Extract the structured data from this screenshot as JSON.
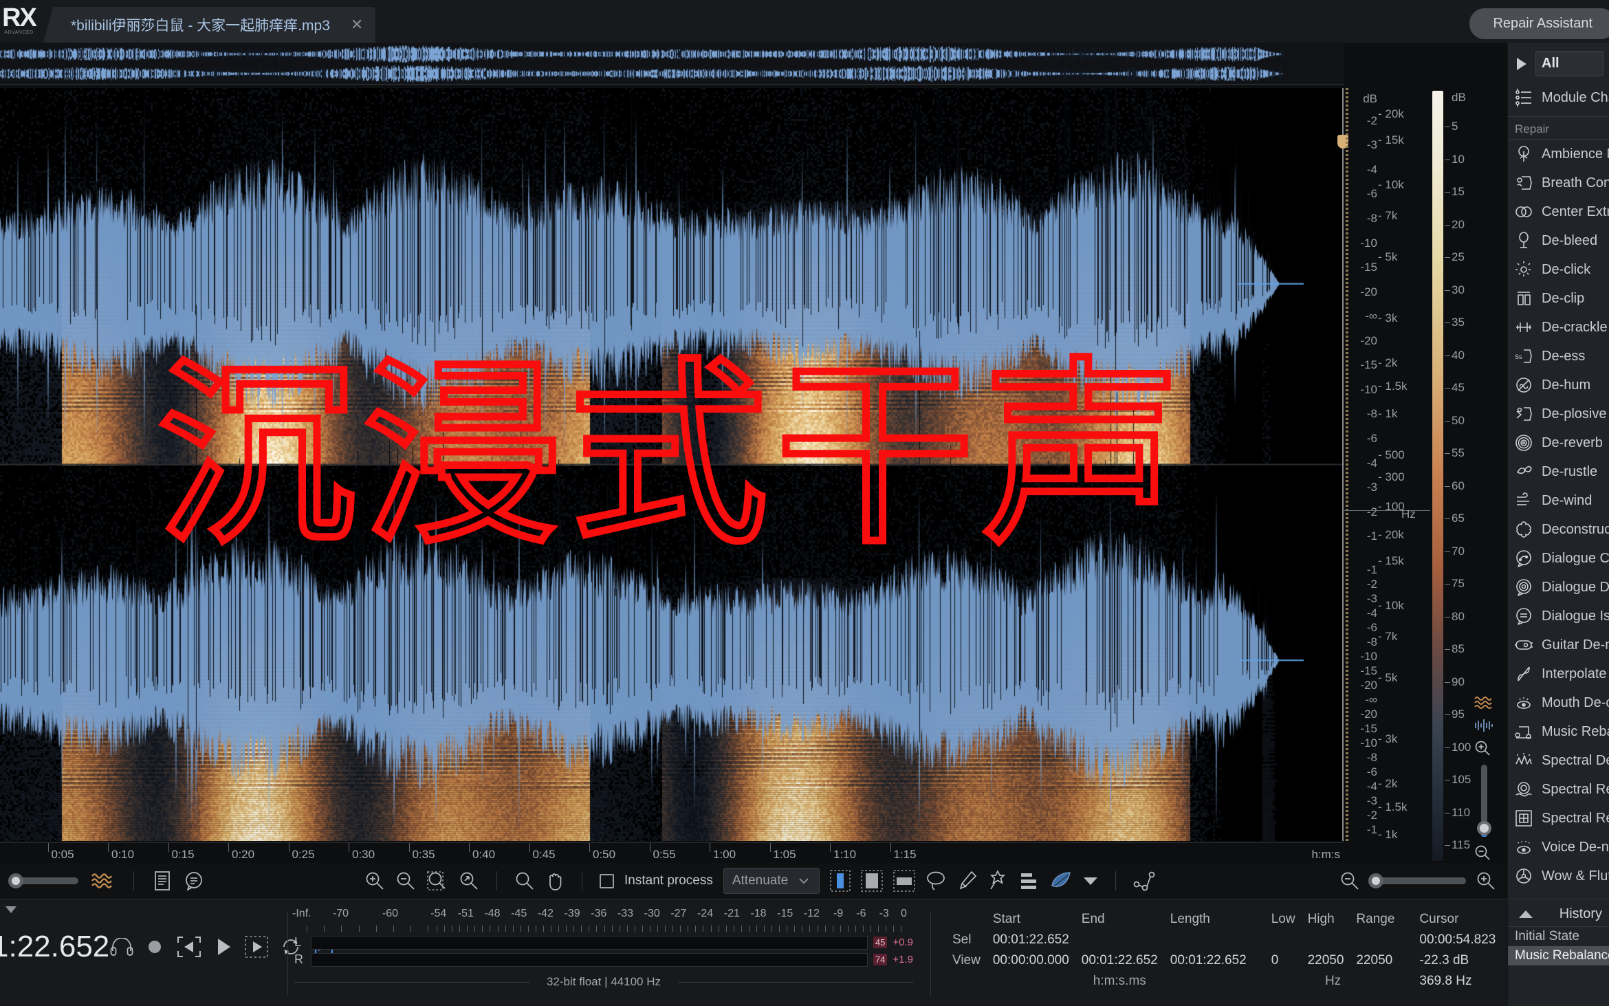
{
  "app": {
    "logo_mark": "RX",
    "logo_sub": "ADVANCED"
  },
  "titlebar": {
    "tab_label": "*bilibili伊丽莎白鼠 - 大家一起肺痒痒.mp3",
    "tab_close": "✕",
    "repair_assistant": "Repair Assistant"
  },
  "watermark": {
    "text": "沉浸式干声",
    "color": "#fa0d0d"
  },
  "axes": {
    "db_label": "dB",
    "hz_label": "Hz",
    "colorbar_db_label": "dB",
    "db_ticks_top": [
      "-2",
      "-3",
      "-4",
      "-6",
      "-8",
      "-10",
      "-15",
      "-20",
      "-∞",
      "-20",
      "-15",
      "-10",
      "-8",
      "-6",
      "-4",
      "-3",
      "-2",
      "-1"
    ],
    "db_ticks_bottom": [
      "-1",
      "-2",
      "-3",
      "-4",
      "-6",
      "-8",
      "-10",
      "-15",
      "-20",
      "-∞",
      "-20",
      "-15",
      "-10",
      "-8",
      "-6",
      "-4",
      "-3",
      "-2",
      "-1"
    ],
    "hz_ticks": [
      "20k",
      "15k",
      "10k",
      "7k",
      "5k",
      "3k",
      "2k",
      "1.5k",
      "1k",
      "500",
      "300",
      "100"
    ],
    "colorbar_ticks": [
      "5",
      "10",
      "15",
      "20",
      "25",
      "30",
      "35",
      "40",
      "45",
      "50",
      "55",
      "60",
      "65",
      "70",
      "75",
      "80",
      "85",
      "90",
      "95",
      "100",
      "105",
      "110",
      "115"
    ]
  },
  "ruler": {
    "labels": [
      "0:05",
      "0:10",
      "0:15",
      "0:20",
      "0:25",
      "0:30",
      "0:35",
      "0:40",
      "0:45",
      "0:50",
      "0:55",
      "1:00",
      "1:05",
      "1:10",
      "1:15"
    ],
    "unit": "h:m:s"
  },
  "toolbar": {
    "zoom_in": "zoom-in",
    "zoom_out": "zoom-out",
    "zoom_selection": "zoom-to-selection",
    "zoom_fit": "zoom-fit",
    "magnifier": "magnifier-tool",
    "hand": "hand-tool",
    "instant_process_label": "Instant process",
    "instant_process_mode": "Attenuate",
    "tools": [
      "time-selection-tool",
      "frequency-selection-tool",
      "time-frequency-selection-tool",
      "lasso-selection-tool",
      "brush-selection-tool",
      "magic-wand-selection-tool",
      "harmonic-selection-tool",
      "feather-tool"
    ],
    "left_slider_name": "waveform-opacity-slider",
    "spectrogram_toggle": "spectrogram-toggle",
    "notes_icon": "notes-icon",
    "comment_icon": "comment-icon",
    "zoom_out_h": "horizontal-zoom-out",
    "zoom_in_h": "horizontal-zoom-in"
  },
  "transport": {
    "time": "1:22.652",
    "buttons": [
      "headphone-monitor",
      "record",
      "play-selection",
      "play",
      "play-loop-region",
      "loop",
      "play-to-end"
    ]
  },
  "meters": {
    "scale": [
      "-Inf.",
      "-70",
      "-60",
      "-54",
      "-51",
      "-48",
      "-45",
      "-42",
      "-39",
      "-36",
      "-33",
      "-30",
      "-27",
      "-24",
      "-21",
      "-18",
      "-15",
      "-12",
      "-9",
      "-6",
      "-3",
      "0"
    ],
    "channels": [
      {
        "name": "L",
        "peak_badge": "45",
        "peak": "+0.9"
      },
      {
        "name": "R",
        "peak_badge": "74",
        "peak": "+1.9"
      }
    ],
    "format": "32-bit float | 44100 Hz"
  },
  "info": {
    "headers": [
      "Start",
      "End",
      "Length"
    ],
    "rows": [
      {
        "label": "Sel",
        "start": "00:01:22.652",
        "end": "",
        "length": ""
      },
      {
        "label": "View",
        "start": "00:00:00.000",
        "end": "00:01:22.652",
        "length": "00:01:22.652"
      }
    ],
    "time_units": "h:m:s.ms",
    "freq_headers": [
      "Low",
      "High",
      "Range"
    ],
    "freq_rows": [
      {
        "low": "",
        "high": "",
        "range": ""
      },
      {
        "low": "0",
        "high": "22050",
        "range": "22050"
      }
    ],
    "freq_units": "Hz",
    "cursor_header": "Cursor",
    "cursor_time": "00:00:54.823",
    "cursor_db": "-22.3 dB",
    "cursor_hz": "369.8 Hz"
  },
  "modules": {
    "expand_icon": "play-triangle-icon",
    "filter_value": "All",
    "module_chain": {
      "label": "Module Chain",
      "icon": "module-chain-icon"
    },
    "group_label": "Repair",
    "items": [
      {
        "label": "Ambience Match",
        "icon": "ambience-icon"
      },
      {
        "label": "Breath Control",
        "icon": "breath-icon"
      },
      {
        "label": "Center Extract",
        "icon": "center-extract-icon"
      },
      {
        "label": "De-bleed",
        "icon": "de-bleed-icon"
      },
      {
        "label": "De-click",
        "icon": "de-click-icon"
      },
      {
        "label": "De-clip",
        "icon": "de-clip-icon"
      },
      {
        "label": "De-crackle",
        "icon": "de-crackle-icon"
      },
      {
        "label": "De-ess",
        "icon": "de-ess-icon"
      },
      {
        "label": "De-hum",
        "icon": "de-hum-icon"
      },
      {
        "label": "De-plosive",
        "icon": "de-plosive-icon"
      },
      {
        "label": "De-reverb",
        "icon": "de-reverb-icon"
      },
      {
        "label": "De-rustle",
        "icon": "de-rustle-icon"
      },
      {
        "label": "De-wind",
        "icon": "de-wind-icon"
      },
      {
        "label": "Deconstruct",
        "icon": "deconstruct-icon"
      },
      {
        "label": "Dialogue Contour",
        "icon": "dialogue-contour-icon"
      },
      {
        "label": "Dialogue De-reverb",
        "icon": "dialogue-dereverb-icon"
      },
      {
        "label": "Dialogue Isolate",
        "icon": "dialogue-isolate-icon"
      },
      {
        "label": "Guitar De-noise",
        "icon": "guitar-denoise-icon"
      },
      {
        "label": "Interpolate",
        "icon": "interpolate-icon"
      },
      {
        "label": "Mouth De-click",
        "icon": "mouth-declick-icon"
      },
      {
        "label": "Music Rebalance",
        "icon": "music-rebalance-icon"
      },
      {
        "label": "Spectral De-noise",
        "icon": "spectral-denoise-icon"
      },
      {
        "label": "Spectral Recovery",
        "icon": "spectral-recovery-icon"
      },
      {
        "label": "Spectral Repair",
        "icon": "spectral-repair-icon"
      },
      {
        "label": "Voice De-noise",
        "icon": "voice-denoise-icon"
      },
      {
        "label": "Wow & Flutter",
        "icon": "wow-flutter-icon"
      }
    ]
  },
  "history": {
    "collapse_icon": "caret-up-icon",
    "title": "History",
    "items": [
      {
        "label": "Initial State",
        "selected": false
      },
      {
        "label": "Music Rebalance",
        "selected": true
      }
    ]
  }
}
